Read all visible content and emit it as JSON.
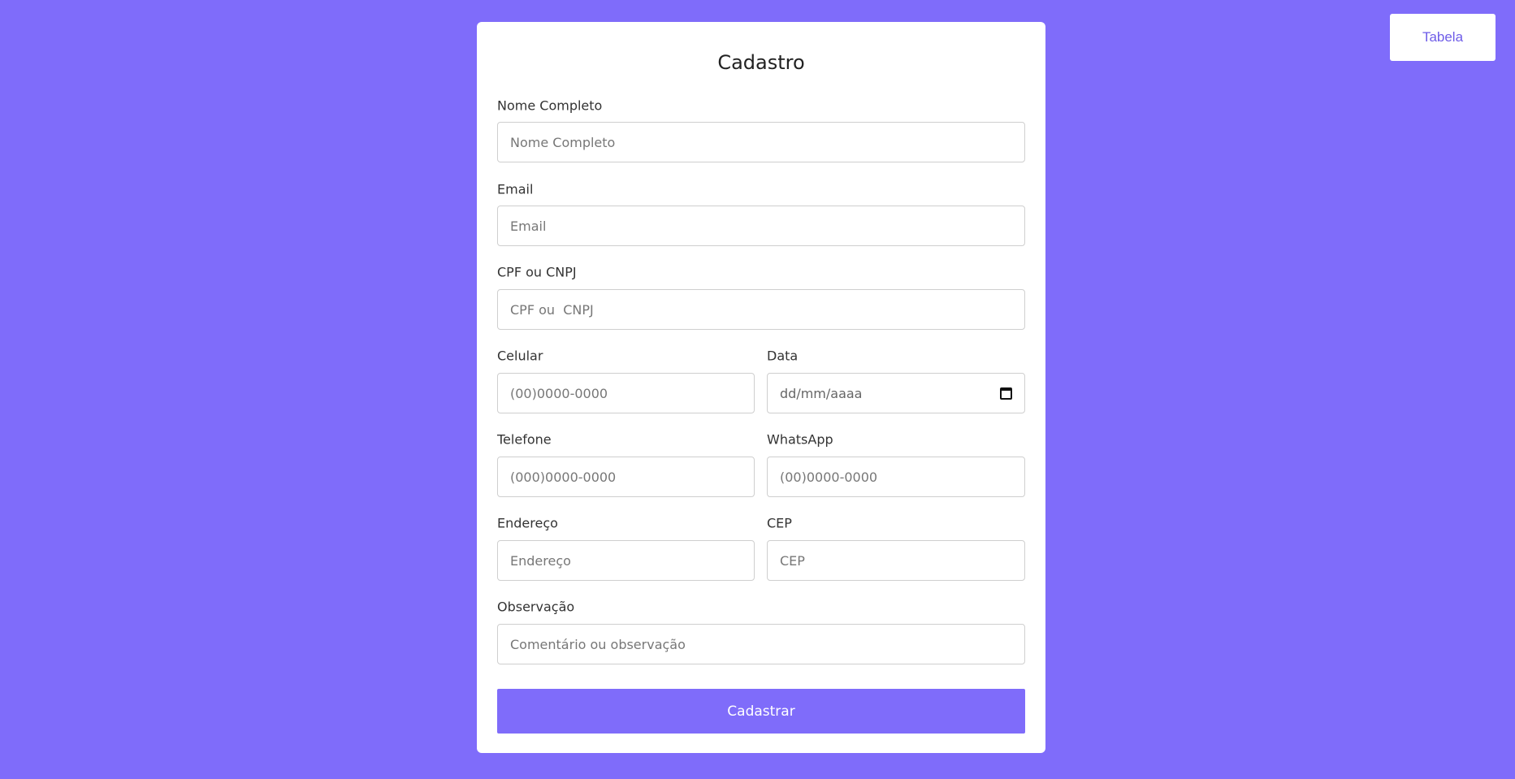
{
  "nav": {
    "table_button": "Tabela"
  },
  "form": {
    "title": "Cadastro",
    "fields": {
      "nome": {
        "label": "Nome Completo",
        "placeholder": "Nome Completo"
      },
      "email": {
        "label": "Email",
        "placeholder": "Email"
      },
      "cpf": {
        "label": "CPF ou CNPJ",
        "placeholder": "CPF ou  CNPJ"
      },
      "celular": {
        "label": "Celular",
        "placeholder": "(00)0000-0000"
      },
      "data": {
        "label": "Data",
        "placeholder": "dd/mm/aaaa"
      },
      "telefone": {
        "label": "Telefone",
        "placeholder": "(000)0000-0000"
      },
      "whatsapp": {
        "label": "WhatsApp",
        "placeholder": "(00)0000-0000"
      },
      "endereco": {
        "label": "Endereço",
        "placeholder": "Endereço"
      },
      "cep": {
        "label": "CEP",
        "placeholder": "CEP"
      },
      "observacao": {
        "label": "Observação",
        "placeholder": "Comentário ou observação"
      }
    },
    "submit_label": "Cadastrar"
  },
  "colors": {
    "background": "#7f6cfa",
    "accent_text": "#6e5ce8"
  }
}
